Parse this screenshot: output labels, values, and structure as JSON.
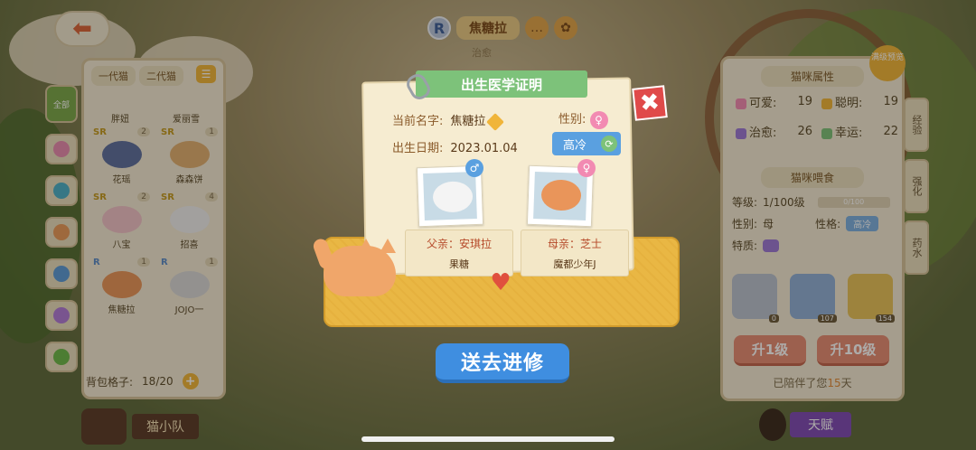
{
  "top_bar": {
    "back_icon": "left-arrow-icon",
    "rarity": "R",
    "cat_name": "焦糖拉",
    "cat_role": "治愈"
  },
  "left_panel": {
    "tabs": [
      "一代猫",
      "二代猫"
    ],
    "side_tabs": [
      {
        "label": "全部"
      },
      {
        "label": ""
      },
      {
        "label": ""
      },
      {
        "label": ""
      },
      {
        "label": ""
      },
      {
        "label": ""
      },
      {
        "label": ""
      }
    ],
    "top_partial_names": [
      "胖妞",
      "爱丽雪"
    ],
    "cats": [
      {
        "rank": "SR",
        "count": "2",
        "name": "花瑶"
      },
      {
        "rank": "SR",
        "count": "1",
        "name": "森森饼"
      },
      {
        "rank": "SR",
        "count": "2",
        "name": "八宝"
      },
      {
        "rank": "SR",
        "count": "4",
        "name": "招喜"
      },
      {
        "rank": "R",
        "count": "1",
        "name": "焦糖拉"
      },
      {
        "rank": "R",
        "count": "1",
        "name": "JOJO一"
      }
    ],
    "bag_label": "背包格子:",
    "bag_value": "18/20",
    "team_label": "猫小队"
  },
  "certificate": {
    "title": "出生医学证明",
    "name_label": "当前名字:",
    "name_value": "焦糖拉",
    "gender_label": "性别:",
    "gender_symbol": "♀",
    "birth_label": "出生日期:",
    "birth_value": "2023.01.04",
    "personality": "高冷",
    "father_label": "父亲：安琪拉",
    "father_name": "果糖",
    "father_symbol": "♂",
    "mother_label": "母亲：芝士",
    "mother_name": "魔都少年J",
    "mother_symbol": "♀",
    "close_symbol": "✖",
    "heart_symbol": "♥"
  },
  "send_button": "送去进修",
  "right_panel": {
    "preview_badge": "满级预览",
    "attr_title": "猫咪属性",
    "attrs": [
      {
        "label": "可爱:",
        "value": "19",
        "color": "#f28ab2"
      },
      {
        "label": "聪明:",
        "value": "19",
        "color": "#f0b53a"
      },
      {
        "label": "治愈:",
        "value": "26",
        "color": "#9b79d6"
      },
      {
        "label": "幸运:",
        "value": "22",
        "color": "#7dc27a"
      }
    ],
    "feed_title": "猫咪喂食",
    "level_label": "等级:",
    "level_value": "1/100级",
    "exp_text": "0/100",
    "gender_label": "性别:",
    "gender_value": "母",
    "personality_label": "性格:",
    "personality_value": "高冷",
    "trait_label": "特质:",
    "foods": [
      {
        "count": "0"
      },
      {
        "count": "107"
      },
      {
        "count": "154"
      }
    ],
    "btn_up1": "升1级",
    "btn_up10": "升10级",
    "companion_prefix": "已陪伴了您",
    "companion_days": "15",
    "companion_suffix": "天",
    "talent_label": "天赋",
    "side_tabs": [
      "经验",
      "强化",
      "药水"
    ]
  },
  "colors": {
    "accent_green": "#7dc27a",
    "accent_blue": "#3f8ee0",
    "close_red": "#e04a4a",
    "envelope_yellow": "#e9b744"
  }
}
